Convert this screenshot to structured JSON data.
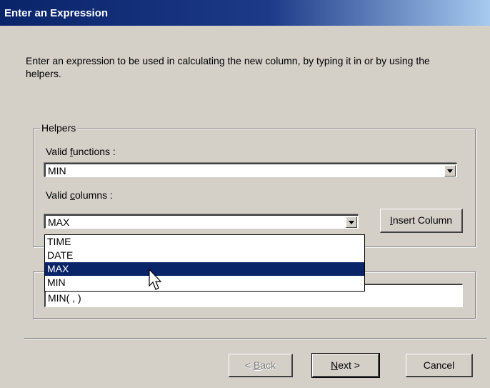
{
  "window": {
    "title": "Enter an Expression"
  },
  "intro_text": "Enter an expression to be used in calculating the new  column, by typing it in or by using the helpers.",
  "helpers": {
    "legend": "Helpers",
    "functions_label_pre": "Valid ",
    "functions_label_accel": "f",
    "functions_label_post": "unctions :",
    "functions_value": "MIN",
    "columns_label_pre": "Valid ",
    "columns_label_accel": "c",
    "columns_label_post": "olumns :",
    "columns_value": "MAX",
    "columns_options": [
      "TIME",
      "DATE",
      "MAX",
      "MIN"
    ],
    "columns_selected_index": 2,
    "insert_button_accel": "I",
    "insert_button_rest": "nsert Column"
  },
  "expression": {
    "value": "MIN( , )"
  },
  "buttons": {
    "back_pre": "< ",
    "back_accel": "B",
    "back_post": "ack",
    "next_accel": "N",
    "next_post": "ext >",
    "cancel": "Cancel"
  },
  "icons": {
    "dropdown": "chevron-down-icon",
    "cursor": "mouse-cursor-icon"
  }
}
